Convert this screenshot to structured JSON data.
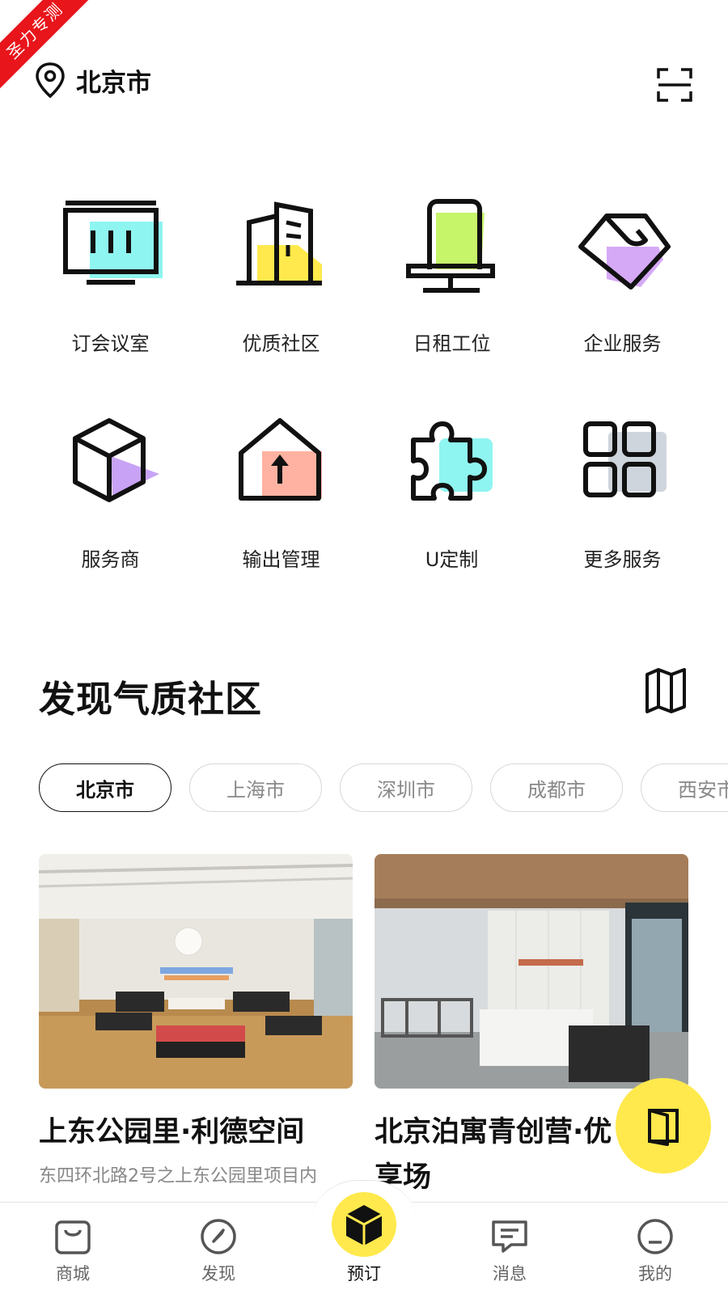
{
  "ribbon": {
    "text": "圣力专测"
  },
  "header": {
    "location": "北京市",
    "location_icon": "location-pin-icon",
    "scan_icon": "scan-icon"
  },
  "services": [
    {
      "label": "订会议室",
      "icon": "meeting-room-icon",
      "accent": "#8ff5f0"
    },
    {
      "label": "优质社区",
      "icon": "building-icon",
      "accent": "#ffe94c"
    },
    {
      "label": "日租工位",
      "icon": "office-chair-icon",
      "accent": "#c6f56a"
    },
    {
      "label": "企业服务",
      "icon": "handshake-icon",
      "accent": "#d6a9f7"
    },
    {
      "label": "服务商",
      "icon": "box-icon",
      "accent": "#c8a3f5"
    },
    {
      "label": "输出管理",
      "icon": "house-arrow-icon",
      "accent": "#ffb2a1"
    },
    {
      "label": "U定制",
      "icon": "puzzle-icon",
      "accent": "#8ff5f0"
    },
    {
      "label": "更多服务",
      "icon": "grid-icon",
      "accent": "#cfd5dc"
    }
  ],
  "section": {
    "title": "发现气质社区",
    "map_icon": "map-icon"
  },
  "city_tabs": [
    {
      "label": "北京市",
      "active": true
    },
    {
      "label": "上海市",
      "active": false
    },
    {
      "label": "深圳市",
      "active": false
    },
    {
      "label": "成都市",
      "active": false
    },
    {
      "label": "西安市",
      "active": false
    }
  ],
  "cards": [
    {
      "title": "上东公园里·利德空间",
      "subtitle": "东四环北路2号之上东公园里项目内",
      "photo": "lounge-photo"
    },
    {
      "title": "北京泊寓青创营·优享场",
      "subtitle": "",
      "photo": "lobby-photo"
    }
  ],
  "fab": {
    "icon": "door-icon"
  },
  "tabbar": [
    {
      "label": "商城",
      "icon": "shopping-bag-icon"
    },
    {
      "label": "发现",
      "icon": "compass-icon"
    },
    {
      "label": "预订",
      "icon": "cube-icon"
    },
    {
      "label": "消息",
      "icon": "message-icon"
    },
    {
      "label": "我的",
      "icon": "smile-icon"
    }
  ],
  "colors": {
    "brand_yellow": "#ffe94c",
    "ribbon_red": "#e8151b"
  }
}
